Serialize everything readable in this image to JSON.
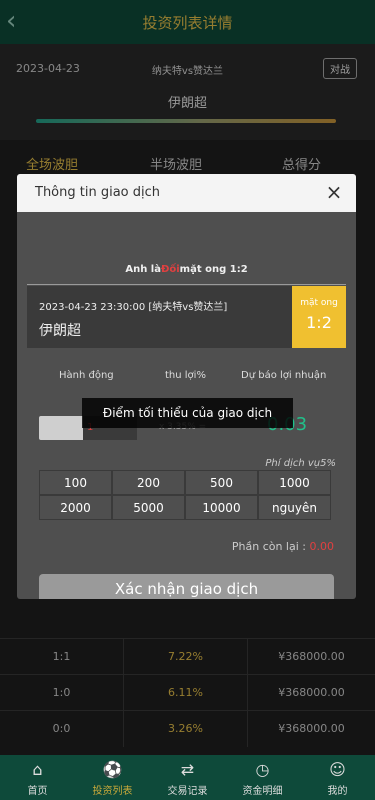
{
  "header": {
    "title": "投资列表详情",
    "back_icon": "chevron-left-icon"
  },
  "match": {
    "date": "2023-04-23",
    "teams": "纳夫特vs赞达兰",
    "vs_button": "对战",
    "league": "伊朗超"
  },
  "tabs": [
    "全场波胆",
    "半场波胆",
    "总得分"
  ],
  "table_rows": [
    {
      "score": "1:1",
      "rate": "7.22%",
      "amount": "¥368000.00"
    },
    {
      "score": "1:0",
      "rate": "6.11%",
      "amount": "¥368000.00"
    },
    {
      "score": "0:0",
      "rate": "3.26%",
      "amount": "¥368000.00"
    }
  ],
  "modal": {
    "title": "Thông tin giao dịch",
    "close_icon": "close-icon",
    "score_prefix": "Anh là",
    "score_red": "Đối",
    "score_suffix": "mặt ong 1:2",
    "match_line": "2023-04-23 23:30:00 [纳夫特vs赞达兰]",
    "league": "伊朗超",
    "badge_label": "mặt ong",
    "badge_score": "1:2",
    "col_action": "Hành động",
    "col_profit": "thu lợi%",
    "col_forecast": "Dự báo lợi nhuận",
    "amount": "1",
    "formula": "x 3.35% =",
    "result": "0.03",
    "toast": "Điểm tối thiểu của giao dịch",
    "fee": "Phí dịch vụ5%",
    "amount_options": [
      "100",
      "200",
      "500",
      "1000",
      "2000",
      "5000",
      "10000",
      "nguyên"
    ],
    "remain_label": "Phần còn lại :",
    "remain_value": "0.00",
    "confirm": "Xác nhận giao dịch"
  },
  "nav": [
    {
      "label": "首页",
      "icon": "home-icon"
    },
    {
      "label": "投资列表",
      "icon": "football-icon"
    },
    {
      "label": "交易记录",
      "icon": "exchange-icon"
    },
    {
      "label": "资金明细",
      "icon": "clock-icon"
    },
    {
      "label": "我的",
      "icon": "user-icon"
    }
  ],
  "colors": {
    "brand": "#0e4a3a",
    "accent": "#e6c04a",
    "badge": "#f0c030",
    "positive": "#21c08a",
    "negative": "#e04040"
  }
}
